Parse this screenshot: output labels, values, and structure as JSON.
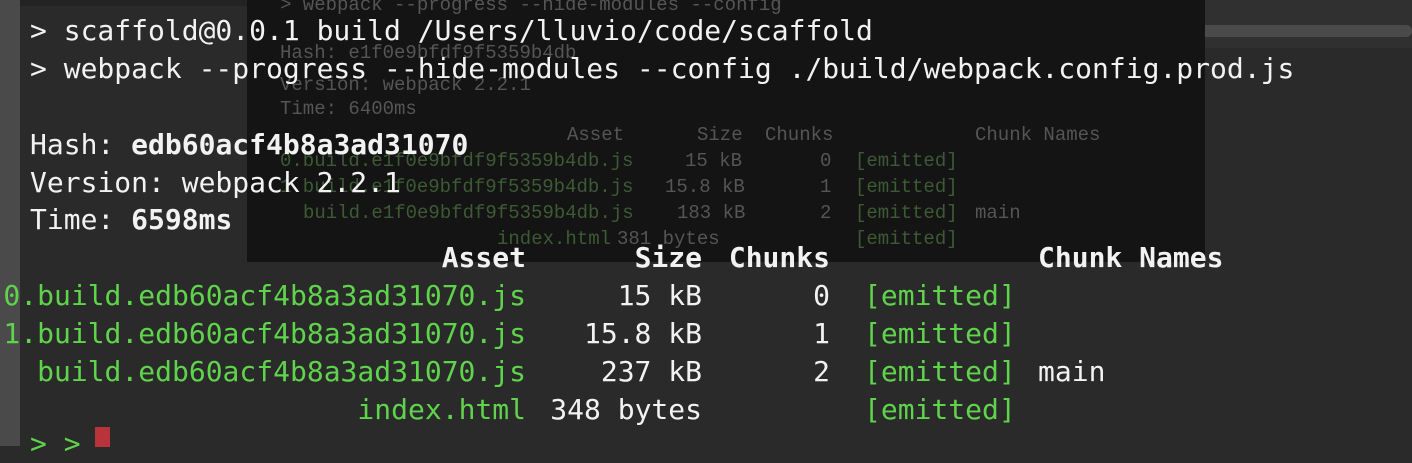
{
  "ghost": {
    "lines": [
      "> webpack --progress --hide-modules --config",
      "Hash: e1f0e9bfdf9f5359b4db",
      "Version: webpack 2.2.1",
      "Time: 6400ms"
    ],
    "table": {
      "headers": [
        "Asset",
        "Size",
        "Chunks",
        "Chunk Names"
      ],
      "rows": [
        {
          "asset": "0.build.e1f0e9bfdf9f5359b4db.js",
          "size": "15 kB",
          "chunk": "0",
          "status": "[emitted]",
          "name": ""
        },
        {
          "asset": "1.build.e1f0e9bfdf9f5359b4db.js",
          "size": "15.8 kB",
          "chunk": "1",
          "status": "[emitted]",
          "name": ""
        },
        {
          "asset": "build.e1f0e9bfdf9f5359b4db.js",
          "size": "183 kB",
          "chunk": "2",
          "status": "[emitted]",
          "name": "main"
        },
        {
          "asset": "index.html",
          "size": "381 bytes",
          "chunk": "",
          "status": "[emitted]",
          "name": ""
        }
      ]
    }
  },
  "terminal": {
    "cmd1": "> scaffold@0.0.1 build /Users/lluvio/code/scaffold",
    "cmd2": "> webpack --progress --hide-modules --config ./build/webpack.config.prod.js",
    "hash_label": "Hash: ",
    "hash_value": "edb60acf4b8a3ad31070",
    "version": "Version: webpack 2.2.1",
    "time_label": "Time: ",
    "time_value": "6598ms",
    "headers": {
      "asset": "Asset",
      "size": "Size",
      "chunks": "Chunks",
      "names": "Chunk Names"
    },
    "rows": [
      {
        "asset": "0.build.edb60acf4b8a3ad31070.js",
        "size": "15 kB",
        "chunk": "0",
        "status": "[emitted]",
        "name": ""
      },
      {
        "asset": "1.build.edb60acf4b8a3ad31070.js",
        "size": "15.8 kB",
        "chunk": "1",
        "status": "[emitted]",
        "name": ""
      },
      {
        "asset": "build.edb60acf4b8a3ad31070.js",
        "size": "237 kB",
        "chunk": "2",
        "status": "[emitted]",
        "name": "main"
      },
      {
        "asset": "index.html",
        "size": "348 bytes",
        "chunk": "",
        "status": "[emitted]",
        "name": ""
      }
    ],
    "prompt": "> >"
  },
  "colors": {
    "green": "#5fd34c",
    "text": "#f2f2f2",
    "cursor": "#b8333a"
  }
}
